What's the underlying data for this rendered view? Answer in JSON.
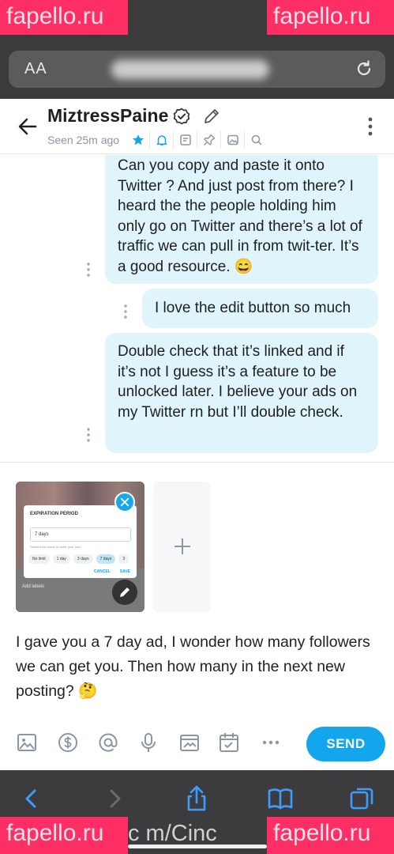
{
  "browser": {
    "aa_label": "AA",
    "url_tail": "c m/Cinc"
  },
  "watermarks": [
    "fapello.ru",
    "fapello.ru",
    "fapello.ru",
    "fapello.ru"
  ],
  "header": {
    "name": "MiztressPaine",
    "seen": "Seen 25m ago"
  },
  "messages": [
    {
      "text": "Can you copy and paste it onto Twitter ? And just post from there? I heard the the people holding him only go on Twitter and there’s a lot of traffic we can pull in from twit-ter. It’s a good resource. 😄"
    },
    {
      "text": "I love the edit button so much"
    },
    {
      "text": "Double check that it’s linked and if it’s not I guess it’s a feature to be unlocked later. I believe your ads on my Twitter rn but I’ll double check."
    }
  ],
  "attachment": {
    "card_title": "EXPIRATION PERIOD",
    "input_value": "7 days",
    "helper": "Select from below or enter your own",
    "chips": [
      "No limit",
      "1 day",
      "3 days",
      "7 days",
      "3"
    ],
    "cancel": "CANCEL",
    "save": "SAVE",
    "labels": "Add labels"
  },
  "composer": {
    "draft": "I gave you a 7 day ad, I wonder how many followers we can get you. Then how many in the next new posting? 🤔",
    "send_label": "SEND"
  },
  "colors": {
    "accent": "#14a6ed",
    "bubble": "#dff4fb",
    "watermark": "#ff2e64",
    "browser_chrome": "#3b3b3c"
  }
}
